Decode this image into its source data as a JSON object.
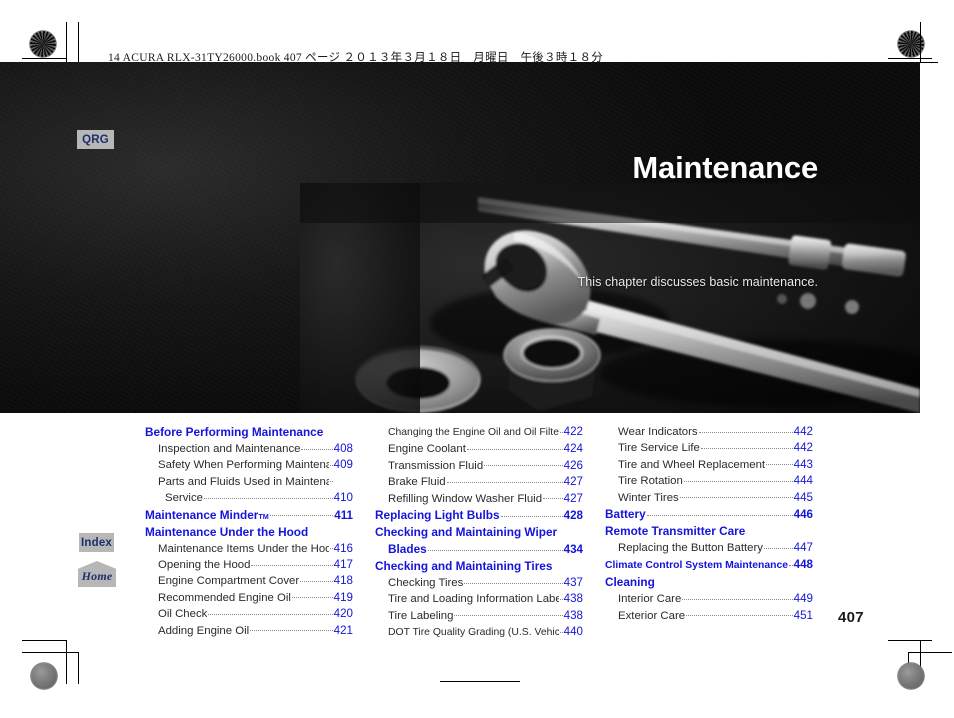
{
  "print_slug": "14 ACURA RLX-31TY26000.book  407 ページ  ２０１３年３月１８日　月曜日　午後３時１８分",
  "folio": "407",
  "hero": {
    "title": "Maintenance",
    "subtitle": "This chapter discusses basic maintenance.",
    "photo_alt": "grayscale-photo-of-combination-wrench-washers-and-socket-extension"
  },
  "tabs": [
    {
      "name": "qrg",
      "label": "QRG"
    },
    {
      "name": "index",
      "label": "Index"
    },
    {
      "name": "home",
      "label": "Home"
    }
  ],
  "colors": {
    "heading_blue": "#1414dc",
    "page_number_blue": "#1414dc",
    "tab_background": "#b7b7b7",
    "tab_text": "#1d2f6b",
    "hero_background": "#101010",
    "body_text": "#2b2b2b"
  },
  "toc": {
    "columns": [
      {
        "rows": [
          {
            "style": "chapter nodots",
            "label": "Before Performing Maintenance",
            "page": ""
          },
          {
            "style": "sub",
            "label": "Inspection and Maintenance",
            "page": "408"
          },
          {
            "style": "sub",
            "label": "Safety When Performing Maintenance",
            "page": "409",
            "dots": "short"
          },
          {
            "style": "cont nodots",
            "label": "Parts and Fluids Used in Maintenance",
            "page": ""
          },
          {
            "style": "sub2",
            "label": "Service",
            "page": "410"
          },
          {
            "style": "chapter",
            "label": "Maintenance Minder",
            "sup": "TM",
            "page": "411"
          },
          {
            "style": "chapter nodots",
            "label": "Maintenance Under the Hood",
            "page": ""
          },
          {
            "style": "sub",
            "label": "Maintenance Items Under the Hood",
            "page": "416"
          },
          {
            "style": "sub",
            "label": "Opening the Hood",
            "page": "417"
          },
          {
            "style": "sub",
            "label": "Engine Compartment Cover",
            "page": "418"
          },
          {
            "style": "sub",
            "label": "Recommended Engine Oil",
            "page": "419"
          },
          {
            "style": "sub",
            "label": "Oil Check",
            "page": "420"
          },
          {
            "style": "sub",
            "label": "Adding Engine Oil",
            "page": "421"
          }
        ]
      },
      {
        "rows": [
          {
            "style": "sub",
            "label": "Changing the Engine Oil and Oil Filter",
            "page": "422",
            "size": "small"
          },
          {
            "style": "sub",
            "label": "Engine Coolant",
            "page": "424"
          },
          {
            "style": "sub",
            "label": "Transmission Fluid",
            "page": "426"
          },
          {
            "style": "sub",
            "label": "Brake Fluid",
            "page": "427"
          },
          {
            "style": "sub",
            "label": "Refilling Window Washer Fluid",
            "page": "427"
          },
          {
            "style": "chapter",
            "label": "Replacing Light Bulbs",
            "page": "428"
          },
          {
            "style": "chapter nodots",
            "label": "Checking and Maintaining Wiper",
            "page": ""
          },
          {
            "style": "chapter wrap2",
            "label": "Blades",
            "page": "434"
          },
          {
            "style": "chapter nodots",
            "label": "Checking and Maintaining Tires",
            "page": ""
          },
          {
            "style": "sub",
            "label": "Checking Tires",
            "page": "437"
          },
          {
            "style": "sub",
            "label": "Tire and Loading Information Label",
            "page": "438"
          },
          {
            "style": "sub",
            "label": "Tire Labeling",
            "page": "438"
          },
          {
            "style": "sub",
            "label": "DOT Tire Quality Grading (U.S. Vehicles)",
            "page": "440",
            "size": "small"
          }
        ]
      },
      {
        "rows": [
          {
            "style": "sub",
            "label": "Wear Indicators",
            "page": "442"
          },
          {
            "style": "sub",
            "label": "Tire Service Life",
            "page": "442"
          },
          {
            "style": "sub",
            "label": "Tire and Wheel Replacement",
            "page": "443"
          },
          {
            "style": "sub",
            "label": "Tire Rotation",
            "page": "444"
          },
          {
            "style": "sub",
            "label": "Winter Tires",
            "page": "445"
          },
          {
            "style": "chapter",
            "label": "Battery",
            "page": "446"
          },
          {
            "style": "chapter nodots",
            "label": "Remote Transmitter Care",
            "page": ""
          },
          {
            "style": "sub",
            "label": "Replacing the Button Battery",
            "page": "447"
          },
          {
            "style": "chapter",
            "label": "Climate Control System Maintenance",
            "page": "448",
            "size": "small"
          },
          {
            "style": "chapter nodots",
            "label": "Cleaning",
            "page": ""
          },
          {
            "style": "sub",
            "label": "Interior Care",
            "page": "449"
          },
          {
            "style": "sub",
            "label": "Exterior Care",
            "page": "451"
          }
        ]
      }
    ]
  }
}
